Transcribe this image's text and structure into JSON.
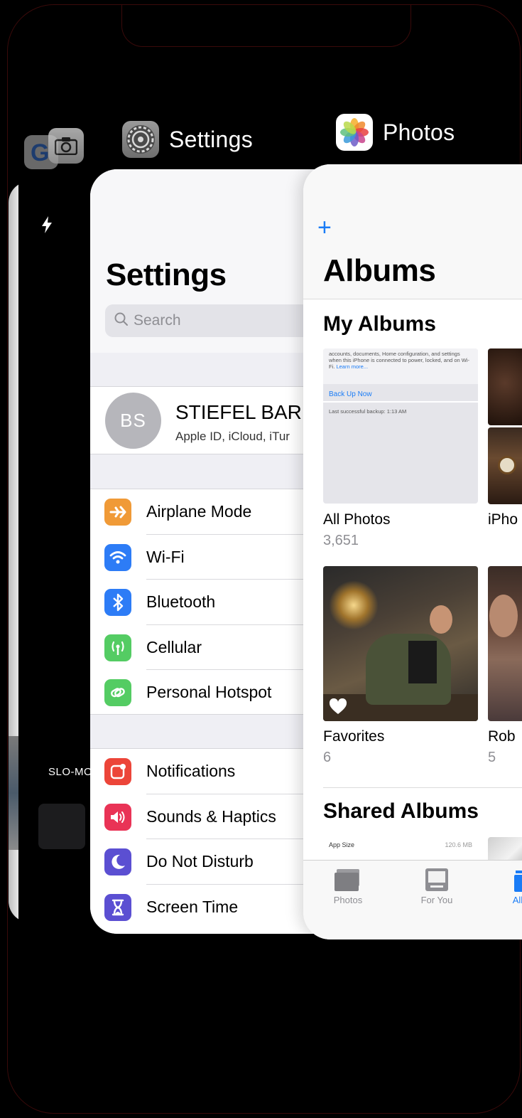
{
  "app_switcher": {
    "settings_label": "Settings",
    "photos_label": "Photos",
    "google_letter": "G"
  },
  "camera": {
    "mode_label": "SLO-MO",
    "icons": [
      "flash-icon",
      "camera-app-icon",
      "google-app-icon"
    ]
  },
  "settings": {
    "title": "Settings",
    "search_placeholder": "Search",
    "profile": {
      "initials": "BS",
      "name": "STIEFEL BAR",
      "subtitle": "Apple ID, iCloud, iTur"
    },
    "group1": [
      {
        "label": "Airplane Mode",
        "icon": "airplane-icon",
        "color": "#f09a37"
      },
      {
        "label": "Wi-Fi",
        "icon": "wifi-icon",
        "color": "#2d7cf6"
      },
      {
        "label": "Bluetooth",
        "icon": "bluetooth-icon",
        "color": "#2d7cf6"
      },
      {
        "label": "Cellular",
        "icon": "cellular-icon",
        "color": "#54cc63"
      },
      {
        "label": "Personal Hotspot",
        "icon": "hotspot-icon",
        "color": "#54cc63"
      }
    ],
    "group2": [
      {
        "label": "Notifications",
        "icon": "notifications-icon",
        "color": "#ec4539"
      },
      {
        "label": "Sounds & Haptics",
        "icon": "sounds-icon",
        "color": "#e93356"
      },
      {
        "label": "Do Not Disturb",
        "icon": "moon-icon",
        "color": "#5b4fd2"
      },
      {
        "label": "Screen Time",
        "icon": "hourglass-icon",
        "color": "#5b4fd2"
      }
    ]
  },
  "photos": {
    "plus": "+",
    "title": "Albums",
    "my_albums_title": "My Albums",
    "all_photos_thumb": {
      "text": "accounts, documents, Home configuration, and settings when this iPhone is connected to power, locked, and on Wi-Fi.",
      "learn_more": "Learn more...",
      "backup_link": "Back Up Now",
      "last_backup": "Last successful backup: 1:13 AM"
    },
    "albums": [
      {
        "name": "All Photos",
        "count": "3,651"
      },
      {
        "name": "iPho",
        "count": ""
      },
      {
        "name": "Favorites",
        "count": "6"
      },
      {
        "name": "Rob",
        "count": "5"
      }
    ],
    "shared_albums_title": "Shared Albums",
    "shared_thumb": {
      "row_label": "App Size",
      "row_value": "120.6 MB"
    },
    "tabs": [
      {
        "label": "Photos",
        "icon": "photos-tab-icon"
      },
      {
        "label": "For You",
        "icon": "for-you-tab-icon"
      },
      {
        "label": "All",
        "icon": "albums-tab-icon"
      }
    ],
    "accent_color": "#1a7cf6"
  }
}
